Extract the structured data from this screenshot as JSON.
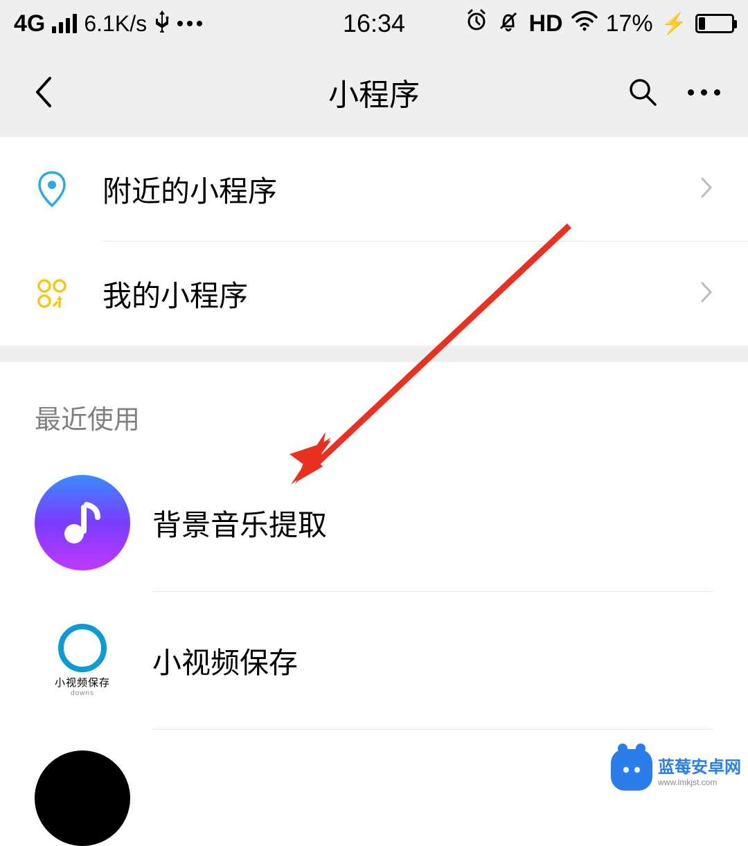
{
  "status": {
    "network": "4G",
    "speed": "6.1K/s",
    "time": "16:34",
    "battery_pct": "17%",
    "hd": "HD"
  },
  "header": {
    "title": "小程序"
  },
  "top_items": [
    {
      "label": "附近的小程序"
    },
    {
      "label": "我的小程序"
    }
  ],
  "recent": {
    "title": "最近使用",
    "items": [
      {
        "label": "背景音乐提取"
      },
      {
        "label": "小视频保存",
        "icon_caption": "小视频保存",
        "icon_sub": "downs"
      }
    ]
  },
  "watermark": {
    "title": "蓝莓安卓网",
    "sub": "www.lmkjst.com"
  }
}
